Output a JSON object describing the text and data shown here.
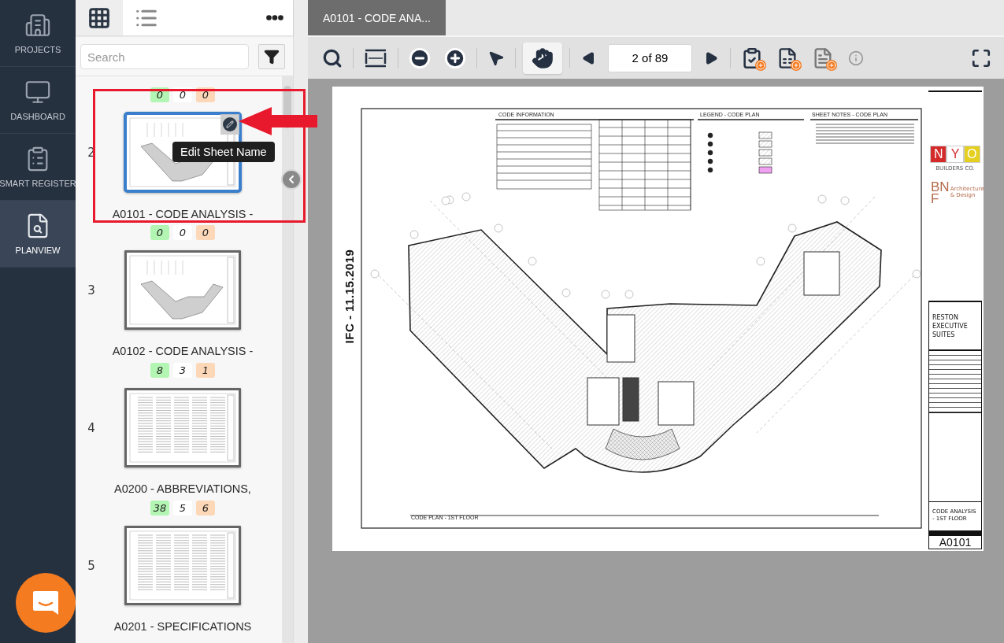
{
  "nav": {
    "items": [
      {
        "label": "PROJECTS",
        "selected": false
      },
      {
        "label": "DASHBOARD",
        "selected": false
      },
      {
        "label": "SMART REGISTER",
        "selected": false
      },
      {
        "label": "PLANVIEW",
        "selected": true
      }
    ]
  },
  "panel": {
    "view_toggle": [
      {
        "selected": true
      },
      {
        "selected": false
      }
    ],
    "search": {
      "placeholder": "Search"
    },
    "sheets": [
      {
        "number": "2",
        "counts": [
          {
            "value": "0",
            "color": "#b3f5b3"
          },
          {
            "value": "0",
            "color": "#ffffff"
          },
          {
            "value": "0",
            "color": "#fdd8b8"
          }
        ],
        "title": "A0101 - CODE ANALYSIS -",
        "kind": "plan",
        "selected": true,
        "hovered": true
      },
      {
        "number": "3",
        "counts": [
          {
            "value": "0",
            "color": "#b3f5b3"
          },
          {
            "value": "0",
            "color": "#ffffff"
          },
          {
            "value": "0",
            "color": "#fdd8b8"
          }
        ],
        "title": "A0102 - CODE ANALYSIS -",
        "kind": "plan",
        "selected": false,
        "hovered": false
      },
      {
        "number": "4",
        "counts": [
          {
            "value": "8",
            "color": "#b3f5b3"
          },
          {
            "value": "3",
            "color": "#ffffff"
          },
          {
            "value": "1",
            "color": "#fdd8b8"
          }
        ],
        "title": "A0200 - ABBREVIATIONS,",
        "kind": "text",
        "selected": false,
        "hovered": false
      },
      {
        "number": "5",
        "counts": [
          {
            "value": "38",
            "color": "#b3f5b3"
          },
          {
            "value": "5",
            "color": "#ffffff"
          },
          {
            "value": "6",
            "color": "#fdd8b8"
          }
        ],
        "title": "A0201 - SPECIFICATIONS",
        "kind": "text",
        "selected": false,
        "hovered": false
      }
    ]
  },
  "tooltip": "Edit Sheet Name",
  "document_tab": {
    "label": "A0101 - CODE ANA...",
    "selected": true
  },
  "toolbar": {
    "pointer_tool": {
      "selected": false
    },
    "hand_tool": {
      "selected": true
    },
    "page_field": {
      "value": "2 of 89"
    }
  },
  "sheet": {
    "stamp": "IFC - 11.15.2019",
    "sections": [
      {
        "title": "CODE INFORMATION"
      },
      {
        "title": "LEGEND - CODE PLAN"
      },
      {
        "title": "SHEET NOTES - CODE PLAN"
      }
    ],
    "plan_caption": "CODE PLAN - 1ST FLOOR",
    "builder_logo": {
      "letters": [
        {
          "text": "N",
          "color": "#d42a2a"
        },
        {
          "text": "Y",
          "color": "#ffffff"
        },
        {
          "text": "O",
          "color": "#e5cf1f"
        }
      ],
      "caption": "BUILDERS CO."
    },
    "architect_logo": {
      "mark": "BN",
      "mark_2": "F",
      "caption": "Architecture & Design"
    },
    "project": "RESTON EXECUTIVE SUITES",
    "drawing_title": "CODE ANALYSIS - 1ST FLOOR",
    "sheet_number": "A0101"
  }
}
